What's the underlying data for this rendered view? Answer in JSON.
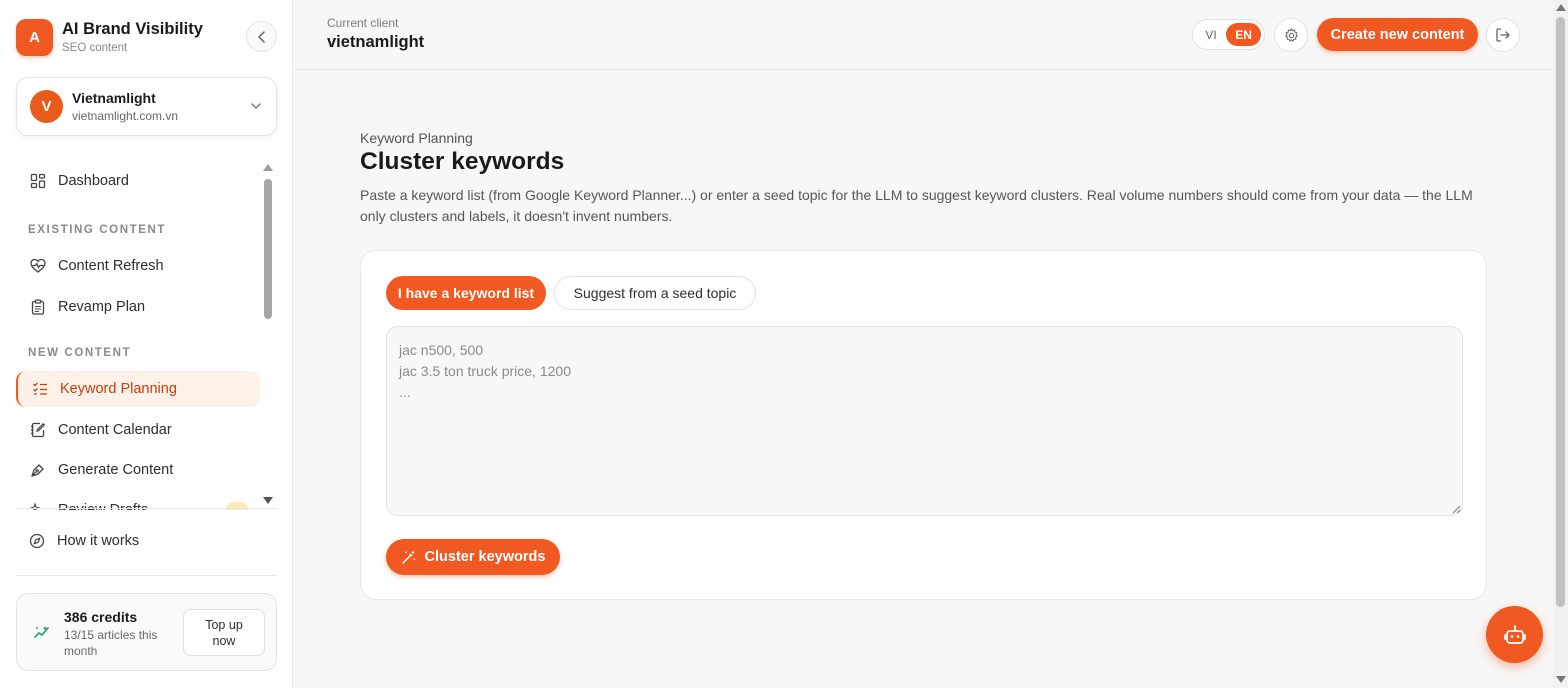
{
  "brand": {
    "logo_letter": "A",
    "title": "AI Brand Visibility",
    "subtitle": "SEO content"
  },
  "client_switcher": {
    "avatar_letter": "V",
    "name": "Vietnamlight",
    "domain": "vietnamlight.com.vn"
  },
  "sidebar": {
    "dashboard": "Dashboard",
    "section_existing": "EXISTING CONTENT",
    "content_refresh": "Content Refresh",
    "revamp_plan": "Revamp Plan",
    "section_new": "NEW CONTENT",
    "keyword_planning": "Keyword Planning",
    "content_calendar": "Content Calendar",
    "generate_content": "Generate Content",
    "review_drafts": "Review Drafts",
    "how_it_works": "How it works"
  },
  "credits": {
    "amount": "386 credits",
    "note": "13/15 articles this month",
    "topup": "Top up now"
  },
  "header": {
    "current_label": "Current client",
    "current_name": "vietnamlight",
    "lang_vi": "VI",
    "lang_en": "EN",
    "create_button": "Create new content"
  },
  "main": {
    "eyebrow": "Keyword Planning",
    "title": "Cluster keywords",
    "description": "Paste a keyword list (from Google Keyword Planner...) or enter a seed topic for the LLM to suggest keyword clusters. Real volume numbers should come from your data — the LLM only clusters and labels, it doesn't invent numbers.",
    "tab_active": "I have a keyword list",
    "tab_inactive": "Suggest from a seed topic",
    "textarea_placeholder": "jac n500, 500\njac 3.5 ton truck price, 1200\n...",
    "cluster_button": "Cluster keywords"
  },
  "colors": {
    "accent": "#f05a22",
    "active_bg": "#fdf1ea",
    "active_text": "#c2410c"
  }
}
